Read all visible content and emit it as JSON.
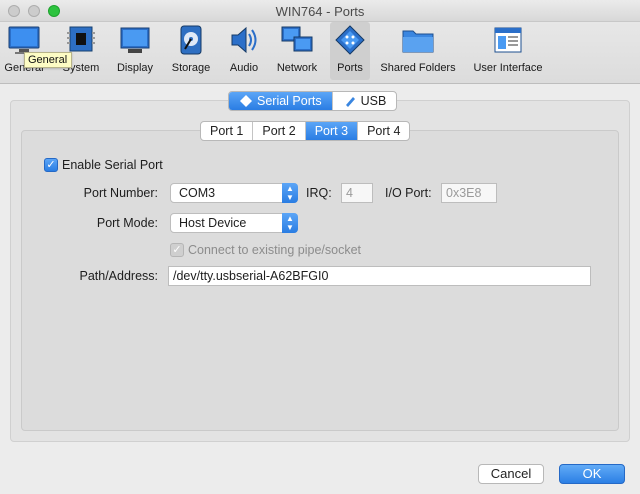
{
  "window": {
    "title": "WIN764 - Ports"
  },
  "toolbar": {
    "items": [
      {
        "label": "General",
        "icon": "monitor-icon"
      },
      {
        "label": "System",
        "icon": "chip-icon"
      },
      {
        "label": "Display",
        "icon": "display-icon"
      },
      {
        "label": "Storage",
        "icon": "disk-icon"
      },
      {
        "label": "Audio",
        "icon": "speaker-icon"
      },
      {
        "label": "Network",
        "icon": "network-icon"
      },
      {
        "label": "Ports",
        "icon": "port-icon"
      },
      {
        "label": "Shared Folders",
        "icon": "folder-icon"
      },
      {
        "label": "User Interface",
        "icon": "window-icon"
      }
    ],
    "selected": "Ports",
    "tooltip": "General"
  },
  "tabs": {
    "serial": "Serial Ports",
    "usb": "USB"
  },
  "port_tabs": [
    "Port 1",
    "Port 2",
    "Port 3",
    "Port 4"
  ],
  "form": {
    "enable_label": "Enable Serial Port",
    "port_number_label": "Port Number:",
    "port_number_value": "COM3",
    "irq_label": "IRQ:",
    "irq_value": "4",
    "io_port_label": "I/O Port:",
    "io_port_value": "0x3E8",
    "port_mode_label": "Port Mode:",
    "port_mode_value": "Host Device",
    "connect_label": "Connect to existing pipe/socket",
    "path_label": "Path/Address:",
    "path_value": "/dev/tty.usbserial-A62BFGI0"
  },
  "buttons": {
    "cancel": "Cancel",
    "ok": "OK"
  },
  "colors": {
    "accent": "#2a7de3",
    "tooltip_bg": "#fdfcc4"
  }
}
